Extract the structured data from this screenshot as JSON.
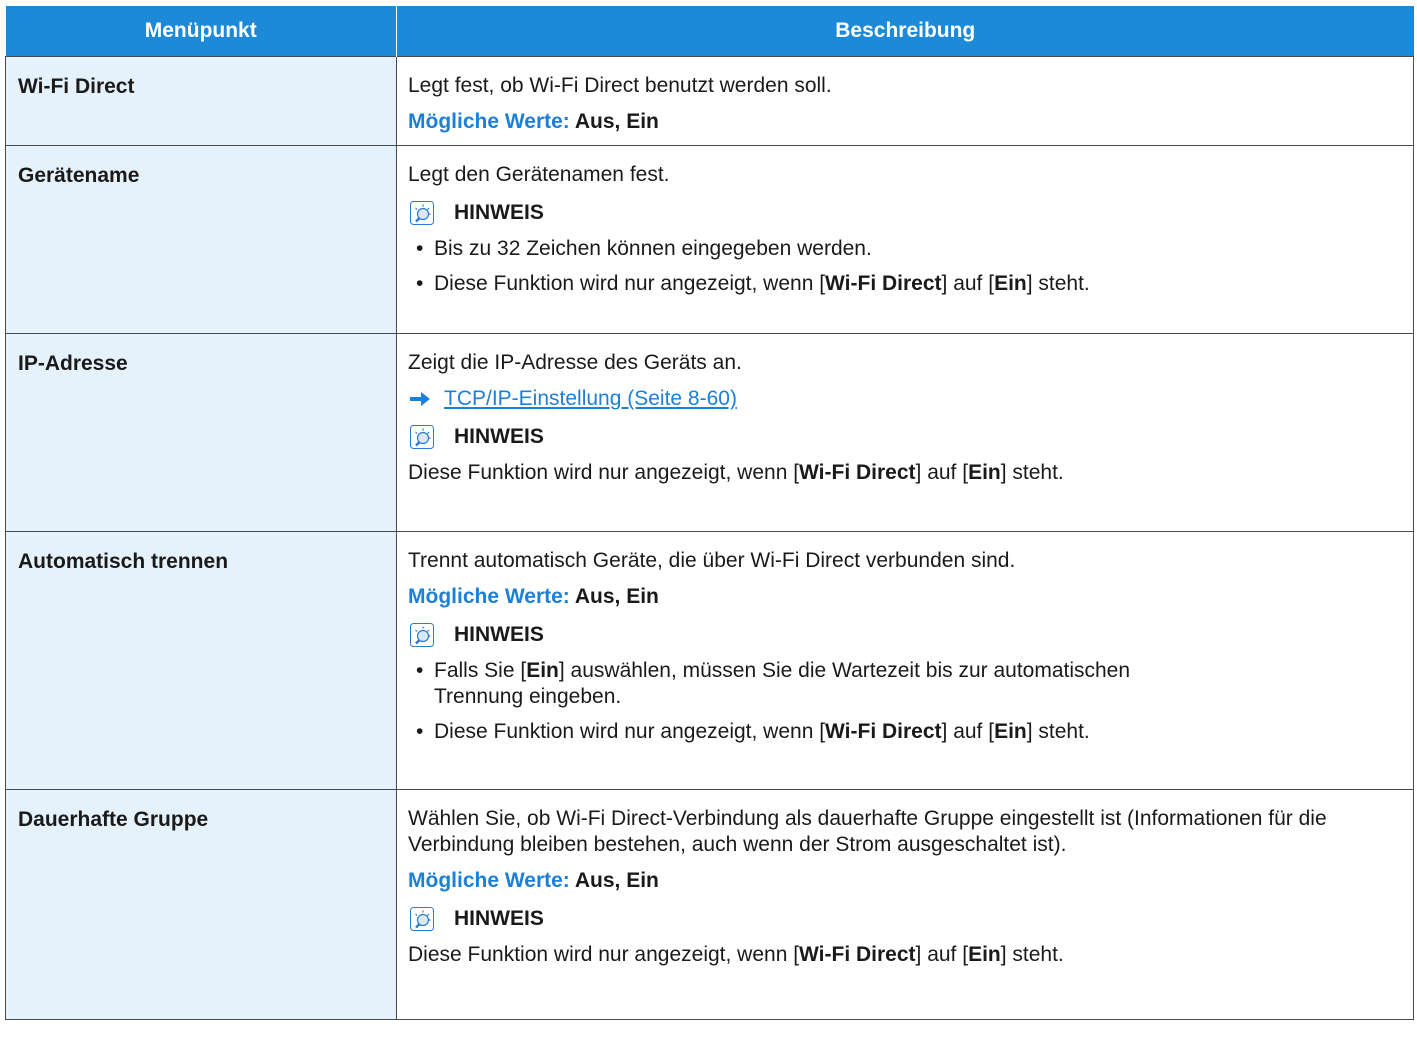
{
  "header": {
    "col_item": "Menüpunkt",
    "col_desc": "Beschreibung"
  },
  "labels": {
    "values_label": "Mögliche Werte:",
    "note": "HINWEIS",
    "ein": "Ein",
    "wifi_direct": "Wi-Fi Direct"
  },
  "rows": [
    {
      "item": "Wi-Fi Direct",
      "desc": "Legt fest, ob Wi-Fi Direct benutzt werden soll.",
      "values": "Aus, Ein"
    },
    {
      "item": "Gerätename",
      "desc": "Legt den Gerätenamen fest.",
      "note_bullets": [
        "Bis zu 32 Zeichen können eingegeben werden.",
        "Diese Funktion wird nur angezeigt, wenn [Wi-Fi Direct] auf [Ein] steht."
      ]
    },
    {
      "item": "IP-Adresse",
      "desc": "Zeigt die IP-Adresse des Geräts an.",
      "link": "TCP/IP-Einstellung (Seite 8-60)",
      "note_text": "Diese Funktion wird nur angezeigt, wenn [Wi-Fi Direct] auf [Ein] steht."
    },
    {
      "item": "Automatisch trennen",
      "desc": "Trennt automatisch Geräte, die über Wi-Fi Direct verbunden sind.",
      "values": "Aus, Ein",
      "note_bullets": [
        "Falls Sie [Ein] auswählen, müssen Sie die Wartezeit bis zur automatischen Trennung eingeben.",
        "Diese Funktion wird nur angezeigt, wenn [Wi-Fi Direct] auf [Ein] steht."
      ]
    },
    {
      "item": "Dauerhafte Gruppe",
      "desc": "Wählen Sie, ob Wi-Fi Direct-Verbindung als dauerhafte Gruppe eingestellt ist (Informationen für die Verbindung bleiben bestehen, auch wenn der Strom ausgeschaltet ist).",
      "values": "Aus, Ein",
      "note_text": "Diese Funktion wird nur angezeigt, wenn [Wi-Fi Direct] auf [Ein] steht."
    }
  ]
}
